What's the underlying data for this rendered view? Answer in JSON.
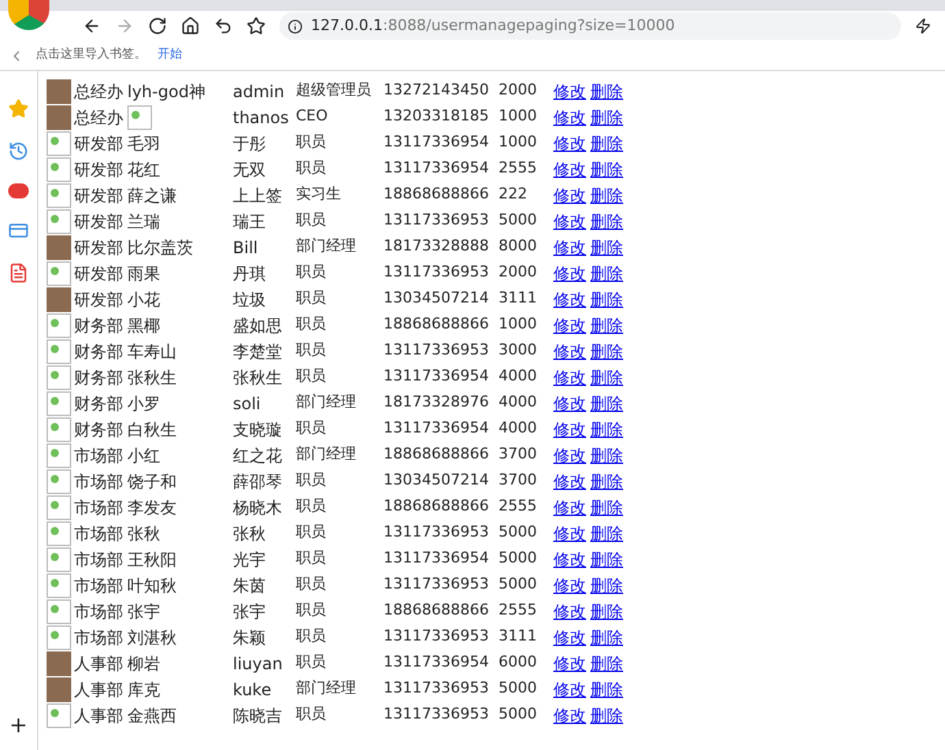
{
  "address_bar": {
    "host": "127.0.0.1",
    "path": ":8088/usermanagepaging?size=10000"
  },
  "bookmarks_bar": {
    "hint": "点击这里导入书签。",
    "link": "开始"
  },
  "sidebar": {
    "add": "+"
  },
  "rows": [
    {
      "avatar": {
        "kind": "photo"
      },
      "dept": "总经办",
      "name": "lyh-god神",
      "nickname": "admin",
      "role": "超级管理员",
      "phone": "13272143450",
      "salary": "2000",
      "edit": "修改",
      "delete": "删除"
    },
    {
      "avatar": {
        "kind": "photo"
      },
      "dept": "总经办",
      "name_image": {
        "kind": "broken"
      },
      "nickname": "thanos",
      "role": "CEO",
      "phone": "13203318185",
      "salary": "1000",
      "edit": "修改",
      "delete": "删除"
    },
    {
      "avatar": {
        "kind": "broken"
      },
      "dept": "研发部",
      "name": "毛羽",
      "nickname": "于彤",
      "role": "职员",
      "phone": "13117336954",
      "salary": "1000",
      "edit": "修改",
      "delete": "删除"
    },
    {
      "avatar": {
        "kind": "broken"
      },
      "dept": "研发部",
      "name": "花红",
      "nickname": "无双",
      "role": "职员",
      "phone": "13117336954",
      "salary": "2555",
      "edit": "修改",
      "delete": "删除"
    },
    {
      "avatar": {
        "kind": "broken"
      },
      "dept": "研发部",
      "name": "薛之谦",
      "nickname": "上上签",
      "role": "实习生",
      "phone": "18868688866",
      "salary": "222",
      "edit": "修改",
      "delete": "删除"
    },
    {
      "avatar": {
        "kind": "broken"
      },
      "dept": "研发部",
      "name": "兰瑞",
      "nickname": "瑞王",
      "role": "职员",
      "phone": "13117336953",
      "salary": "5000",
      "edit": "修改",
      "delete": "删除"
    },
    {
      "avatar": {
        "kind": "photo"
      },
      "dept": "研发部",
      "name": "比尔盖茨",
      "nickname": "Bill",
      "role": "部门经理",
      "phone": "18173328888",
      "salary": "8000",
      "edit": "修改",
      "delete": "删除"
    },
    {
      "avatar": {
        "kind": "broken"
      },
      "dept": "研发部",
      "name": "雨果",
      "nickname": "丹琪",
      "role": "职员",
      "phone": "13117336953",
      "salary": "2000",
      "edit": "修改",
      "delete": "删除"
    },
    {
      "avatar": {
        "kind": "photo"
      },
      "dept": "研发部",
      "name": "小花",
      "nickname": "垃圾",
      "role": "职员",
      "phone": "13034507214",
      "salary": "3111",
      "edit": "修改",
      "delete": "删除"
    },
    {
      "avatar": {
        "kind": "broken"
      },
      "dept": "财务部",
      "name": "黑椰",
      "nickname": "盛如思",
      "role": "职员",
      "phone": "18868688866",
      "salary": "1000",
      "edit": "修改",
      "delete": "删除"
    },
    {
      "avatar": {
        "kind": "broken"
      },
      "dept": "财务部",
      "name": "车寿山",
      "nickname": "李楚堂",
      "role": "职员",
      "phone": "13117336953",
      "salary": "3000",
      "edit": "修改",
      "delete": "删除"
    },
    {
      "avatar": {
        "kind": "broken"
      },
      "dept": "财务部",
      "name": "张秋生",
      "nickname": "张秋生",
      "role": "职员",
      "phone": "13117336954",
      "salary": "4000",
      "edit": "修改",
      "delete": "删除"
    },
    {
      "avatar": {
        "kind": "broken"
      },
      "dept": "财务部",
      "name": "小罗",
      "nickname": "soli",
      "role": "部门经理",
      "phone": "18173328976",
      "salary": "4000",
      "edit": "修改",
      "delete": "删除"
    },
    {
      "avatar": {
        "kind": "broken"
      },
      "dept": "财务部",
      "name": "白秋生",
      "nickname": "支晓璇",
      "role": "职员",
      "phone": "13117336954",
      "salary": "4000",
      "edit": "修改",
      "delete": "删除"
    },
    {
      "avatar": {
        "kind": "broken"
      },
      "dept": "市场部",
      "name": "小红",
      "nickname": "红之花",
      "role": "部门经理",
      "phone": "18868688866",
      "salary": "3700",
      "edit": "修改",
      "delete": "删除"
    },
    {
      "avatar": {
        "kind": "broken"
      },
      "dept": "市场部",
      "name": "饶子和",
      "nickname": "薛邵琴",
      "role": "职员",
      "phone": "13034507214",
      "salary": "3700",
      "edit": "修改",
      "delete": "删除"
    },
    {
      "avatar": {
        "kind": "broken"
      },
      "dept": "市场部",
      "name": "李发友",
      "nickname": "杨晓木",
      "role": "职员",
      "phone": "18868688866",
      "salary": "2555",
      "edit": "修改",
      "delete": "删除"
    },
    {
      "avatar": {
        "kind": "broken"
      },
      "dept": "市场部",
      "name": "张秋",
      "nickname": "张秋",
      "role": "职员",
      "phone": "13117336953",
      "salary": "5000",
      "edit": "修改",
      "delete": "删除"
    },
    {
      "avatar": {
        "kind": "broken"
      },
      "dept": "市场部",
      "name": "王秋阳",
      "nickname": "光宇",
      "role": "职员",
      "phone": "13117336954",
      "salary": "5000",
      "edit": "修改",
      "delete": "删除"
    },
    {
      "avatar": {
        "kind": "broken"
      },
      "dept": "市场部",
      "name": "叶知秋",
      "nickname": "朱茵",
      "role": "职员",
      "phone": "13117336953",
      "salary": "5000",
      "edit": "修改",
      "delete": "删除"
    },
    {
      "avatar": {
        "kind": "broken"
      },
      "dept": "市场部",
      "name": "张宇",
      "nickname": "张宇",
      "role": "职员",
      "phone": "18868688866",
      "salary": "2555",
      "edit": "修改",
      "delete": "删除"
    },
    {
      "avatar": {
        "kind": "broken"
      },
      "dept": "市场部",
      "name": "刘湛秋",
      "nickname": "朱颖",
      "role": "职员",
      "phone": "13117336953",
      "salary": "3111",
      "edit": "修改",
      "delete": "删除"
    },
    {
      "avatar": {
        "kind": "photo"
      },
      "dept": "人事部",
      "name": "柳岩",
      "nickname": "liuyan",
      "role": "职员",
      "phone": "13117336954",
      "salary": "6000",
      "edit": "修改",
      "delete": "删除"
    },
    {
      "avatar": {
        "kind": "photo"
      },
      "dept": "人事部",
      "name": "库克",
      "nickname": "kuke",
      "role": "部门经理",
      "phone": "13117336953",
      "salary": "5000",
      "edit": "修改",
      "delete": "删除"
    },
    {
      "avatar": {
        "kind": "broken"
      },
      "dept": "人事部",
      "name": "金燕西",
      "nickname": "陈晓吉",
      "role": "职员",
      "phone": "13117336953",
      "salary": "5000",
      "edit": "修改",
      "delete": "删除"
    }
  ]
}
